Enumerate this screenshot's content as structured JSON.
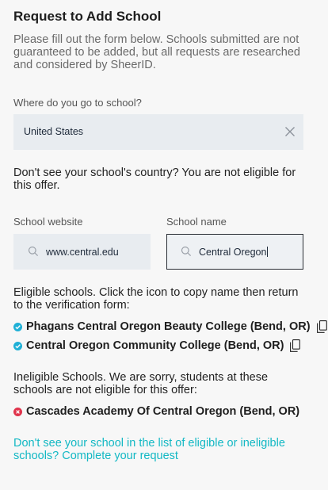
{
  "form": {
    "title": "Request to Add School",
    "intro": "Please fill out the form below. Schools submitted are not guaranteed to be added, but all requests are researched and considered by SheerID.",
    "country_label": "Where do you go to school?",
    "country_value": "United States",
    "country_note": "Don't see your school's country? You are not eligible for this offer.",
    "website_label": "School website",
    "website_value": "www.central.edu",
    "name_label": "School name",
    "name_value": "Central Oregon"
  },
  "eligible": {
    "heading": "Eligible schools. Click the icon to copy name then return to the verification form:",
    "schools": [
      "Phagans Central Oregon Beauty College (Bend, OR)",
      "Central Oregon Community College (Bend, OR)"
    ]
  },
  "ineligible": {
    "heading": "Ineligible Schools. We are sorry, students at these schools are not eligible for this offer:",
    "schools": [
      "Cascades Academy Of Central Oregon (Bend, OR)"
    ]
  },
  "footer_link": "Don't see your school in the list of eligible or ineligible schools? Complete your request",
  "colors": {
    "accent": "#13b8c4",
    "eligible": "#1fb0d6",
    "ineligible": "#e0344c"
  },
  "icons": [
    "close-icon",
    "search-icon",
    "check-circle-icon",
    "copy-icon",
    "x-circle-icon"
  ]
}
